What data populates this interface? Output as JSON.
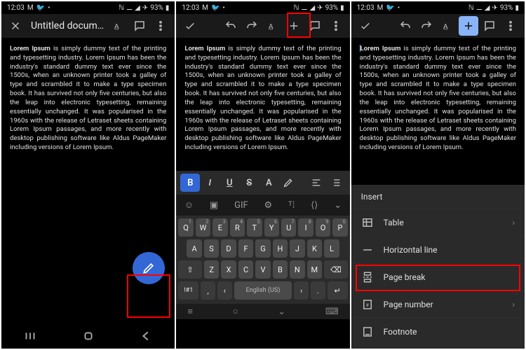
{
  "status": {
    "time": "12:03",
    "left_icons": [
      "M",
      "bird",
      "dot"
    ],
    "right_text": "93%",
    "right_icons": [
      "nfc",
      "wifi",
      "signal",
      "plane",
      "battery"
    ]
  },
  "colors": {
    "accent": "#3367d6",
    "highlight": "#ff0000",
    "active_icon": "#8ab4f8"
  },
  "panel1": {
    "title": "Untitled docum…",
    "body_lead": "Lorem Ipsum",
    "body_rest": " is simply dummy text of the printing and typesetting industry. Lorem Ipsum has been the industry's standard dummy text ever since the 1500s, when an unknown printer took a galley of type and scrambled it to make a type specimen book. It has survived not only five centuries, but also the leap into electronic typesetting, remaining essentially unchanged. It was popularised in the 1960s with the release of Letraset sheets containing Lorem Ipsum passages, and more recently with desktop publishing software like Aldus PageMaker including versions of Lorem Ipsum."
  },
  "panel2": {
    "body_lead": "Lorem Ipsum",
    "body_rest": " is simply dummy text of the printing and typesetting industry. Lorem Ipsum has been the industry's standard dummy text ever since the 1500s, when an unknown printer took a galley of type and scrambled it to make a type specimen book. It has survived not only five centuries, but also the leap into electronic typesetting, remaining essentially unchanged. It was popularised in the 1960s with the release of Letraset sheets containing Lorem Ipsum passages, and more recently with desktop publishing software like Aldus PageMaker including versions of Lorem Ipsum.",
    "fmt": {
      "b": "B",
      "i": "I",
      "u": "U",
      "s": "S",
      "a": "A"
    },
    "kbd": {
      "row_nums": [
        "1",
        "2",
        "3",
        "4",
        "5",
        "6",
        "7",
        "8",
        "9",
        "0"
      ],
      "row1": [
        "Q",
        "W",
        "E",
        "R",
        "T",
        "Y",
        "U",
        "I",
        "O",
        "P"
      ],
      "row2": [
        "A",
        "S",
        "D",
        "F",
        "G",
        "H",
        "J",
        "K",
        "L"
      ],
      "row3": [
        "Z",
        "X",
        "C",
        "V",
        "B",
        "N",
        "M"
      ],
      "lang": "English (US)",
      "sym": "!#1"
    }
  },
  "panel3": {
    "body_lead": "Lorem Ipsum",
    "body_rest": " is simply dummy text of the printing and typesetting industry. Lorem Ipsum has been the industry's standard dummy text ever since the 1500s, when an unknown printer took a galley of type and scrambled it to make a type specimen book. It has survived not only five centuries, but also the leap into electronic typesetting, remaining essentially unchanged. It was popularised in the 1960s with the release of Letraset sheets containing Lorem Ipsum passages, and more recently with desktop publishing software like Aldus PageMaker including versions of Lorem Ipsum.",
    "sheet_title": "Insert",
    "items": [
      {
        "label": "Table",
        "icon": "table",
        "chevron": true
      },
      {
        "label": "Horizontal line",
        "icon": "hr",
        "chevron": false
      },
      {
        "label": "Page break",
        "icon": "pagebreak",
        "chevron": false
      },
      {
        "label": "Page number",
        "icon": "pagenum",
        "chevron": true
      },
      {
        "label": "Footnote",
        "icon": "footnote",
        "chevron": false
      }
    ]
  }
}
